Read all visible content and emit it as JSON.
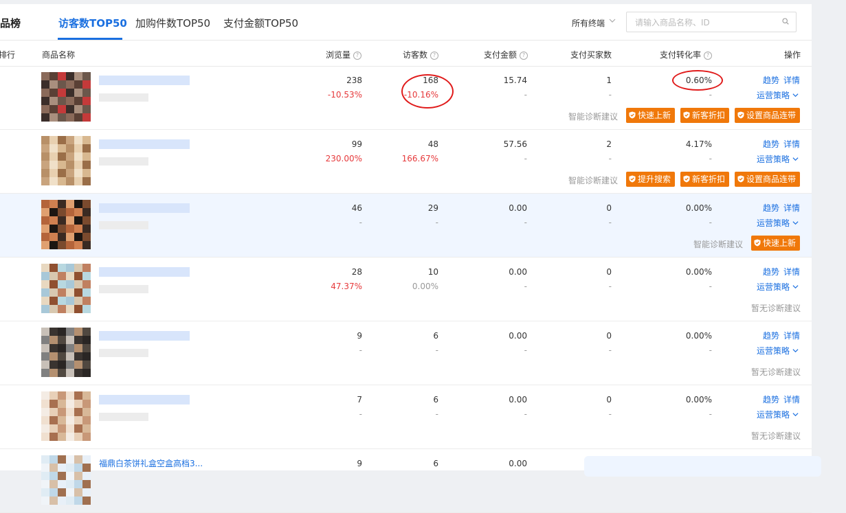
{
  "header": {
    "page_title": "品榜",
    "tabs": [
      {
        "label": "访客数TOP50",
        "active": true
      },
      {
        "label": "加购件数TOP50",
        "active": false
      },
      {
        "label": "支付金额TOP50",
        "active": false
      }
    ],
    "terminal_select": "所有终端",
    "search_placeholder": "请输入商品名称、ID"
  },
  "columns": {
    "rank": "排行",
    "product": "商品名称",
    "views": "浏览量",
    "visitors": "访客数",
    "pay_amount": "支付金额",
    "pay_buyers": "支付买家数",
    "conversion": "支付转化率",
    "actions": "操作"
  },
  "row_actions": {
    "trend": "趋势",
    "detail": "详情",
    "strategy": "运营策略"
  },
  "diagnosis": {
    "label": "智能诊断建议",
    "none": "暂无诊断建议"
  },
  "rows": [
    {
      "views": "238",
      "views_change": "-10.53%",
      "visitors": "168",
      "visitors_change": "-10.16%",
      "pay_amount": "15.74",
      "pay_amount_change": "-",
      "buyers": "1",
      "buyers_change": "-",
      "conversion": "0.60%",
      "conversion_change": "-",
      "tags": [
        "快速上新",
        "新客折扣",
        "设置商品连带"
      ]
    },
    {
      "views": "99",
      "views_change": "230.00%",
      "visitors": "48",
      "visitors_change": "166.67%",
      "pay_amount": "57.56",
      "pay_amount_change": "-",
      "buyers": "2",
      "buyers_change": "-",
      "conversion": "4.17%",
      "conversion_change": "-",
      "tags": [
        "提升搜索",
        "新客折扣",
        "设置商品连带"
      ]
    },
    {
      "views": "46",
      "views_change": "-",
      "visitors": "29",
      "visitors_change": "-",
      "pay_amount": "0.00",
      "pay_amount_change": "-",
      "buyers": "0",
      "buyers_change": "-",
      "conversion": "0.00%",
      "conversion_change": "-",
      "tags": [
        "快速上新"
      ]
    },
    {
      "views": "28",
      "views_change": "47.37%",
      "visitors": "10",
      "visitors_change": "0.00%",
      "pay_amount": "0.00",
      "pay_amount_change": "-",
      "buyers": "0",
      "buyers_change": "-",
      "conversion": "0.00%",
      "conversion_change": "-",
      "tags": []
    },
    {
      "views": "9",
      "views_change": "-",
      "visitors": "6",
      "visitors_change": "-",
      "pay_amount": "0.00",
      "pay_amount_change": "-",
      "buyers": "0",
      "buyers_change": "-",
      "conversion": "0.00%",
      "conversion_change": "-",
      "tags": []
    },
    {
      "views": "7",
      "views_change": "-",
      "visitors": "6",
      "visitors_change": "-",
      "pay_amount": "0.00",
      "pay_amount_change": "-",
      "buyers": "0",
      "buyers_change": "-",
      "conversion": "0.00%",
      "conversion_change": "-",
      "tags": []
    },
    {
      "name": "福鼎白茶饼礼盒空盒高档3...",
      "views": "9",
      "visitors": "6",
      "pay_amount": "0.00"
    }
  ],
  "colors": {
    "accent": "#1a6fe0",
    "tag_orange": "#f0780a",
    "negative_red": "#e6393b",
    "annotation_red": "#e01b1b"
  }
}
